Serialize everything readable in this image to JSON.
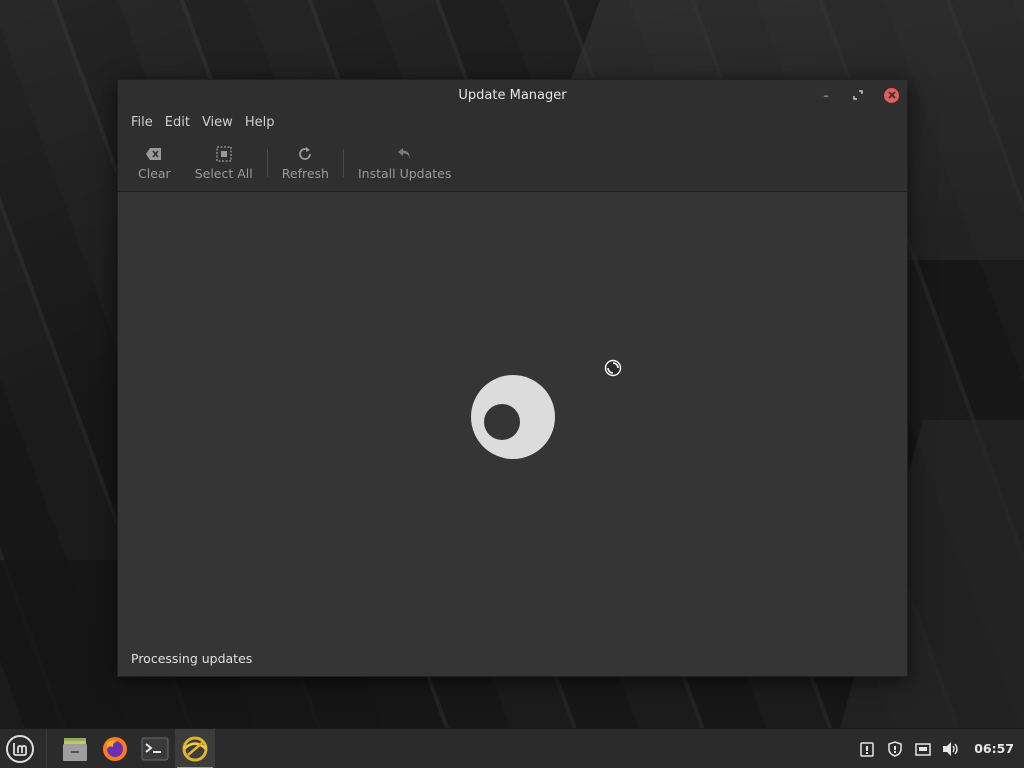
{
  "window": {
    "title": "Update Manager",
    "controls": {
      "minimize": "–",
      "maximize": "⤢",
      "close": "✕"
    }
  },
  "menubar": {
    "items": [
      {
        "label": "File"
      },
      {
        "label": "Edit"
      },
      {
        "label": "View"
      },
      {
        "label": "Help"
      }
    ]
  },
  "toolbar": {
    "clear_label": "Clear",
    "select_all_label": "Select All",
    "refresh_label": "Refresh",
    "install_label": "Install Updates"
  },
  "status": {
    "text": "Processing updates"
  },
  "taskbar": {
    "apps": [
      {
        "name": "menu-icon"
      },
      {
        "name": "files-icon"
      },
      {
        "name": "firefox-icon"
      },
      {
        "name": "terminal-icon"
      },
      {
        "name": "update-manager-icon",
        "active": true
      }
    ],
    "tray": [
      {
        "name": "update-notification-icon"
      },
      {
        "name": "shield-icon"
      },
      {
        "name": "network-icon"
      },
      {
        "name": "volume-icon"
      }
    ],
    "clock": "06:57"
  },
  "colors": {
    "window_bg": "#353535",
    "titlebar_bg": "#2f2f2f",
    "close_button": "#e35d5d",
    "active_indicator": "#8bb158",
    "spinner": "#dcdcdc"
  }
}
